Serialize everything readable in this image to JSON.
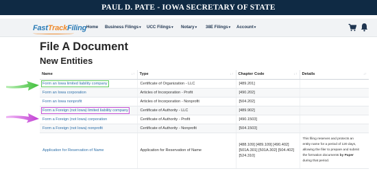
{
  "banner": {
    "title": "PAUL D. PATE - IOWA SECRETARY OF STATE"
  },
  "logo": {
    "part1": "Fast",
    "part2": "Track",
    "part3": "Filing"
  },
  "nav": {
    "home": "Home",
    "business_filings": "Business Filings",
    "ucc_filings": "UCC Filings",
    "notary": "Notary",
    "e38_filings": "38E Filings",
    "account": "Account",
    "caret": "▾",
    "cart_icon": "cart-icon",
    "bell_icon": "bell-icon"
  },
  "page": {
    "title": "File A Document",
    "section": "New Entities"
  },
  "table": {
    "headers": {
      "name": "Name",
      "type": "Type",
      "chapter": "Chapter Code",
      "details": "Details"
    },
    "sort_glyph": "↓↑",
    "rows": [
      {
        "name": "Form an Iowa limited liability company",
        "type": "Certificate of Organization - LLC",
        "chapter": "[489.201]",
        "details": ""
      },
      {
        "name": "Form an Iowa corporation",
        "type": "Articles of Incorporation - Profit",
        "chapter": "[490.202]",
        "details": ""
      },
      {
        "name": "Form an Iowa nonprofit",
        "type": "Articles of Incorporation - Nonprofit",
        "chapter": "[504.202]",
        "details": ""
      },
      {
        "name": "Form a Foreign (not Iowa) limited liability company",
        "type": "Certificate of Authority - LLC",
        "chapter": "[489.902]",
        "details": ""
      },
      {
        "name": "Form a Foreign (not Iowa) corporation",
        "type": "Certificate of Authority - Profit",
        "chapter": "[490.1503]",
        "details": ""
      },
      {
        "name": "Form a Foreign (not Iowa) nonprofit",
        "type": "Certificate of Authority - Nonprofit",
        "chapter": "[504.1503]",
        "details": ""
      },
      {
        "name": "Application for Reservation of Name",
        "type": "Application for Reservation of Name",
        "chapter_line1": "[488.109] [489.109] [490.402]",
        "chapter_line2": "[501A.301] [501A.302] [504.402]",
        "chapter_line3": "[524.310]",
        "details_line1": "This filing reserves and protects an",
        "details_line2": "entity name for a period of 120 days,",
        "details_line3": "allowing the filer to prepare and submit",
        "details_line4a": "the formation documents ",
        "details_line4b": "by Paper",
        "details_line5": "during that period."
      }
    ]
  },
  "colors": {
    "banner": "#0f2a44",
    "link": "#2d6fa8",
    "green_arrow": "#5fc95c",
    "purple_arrow": "#c44fd6"
  }
}
